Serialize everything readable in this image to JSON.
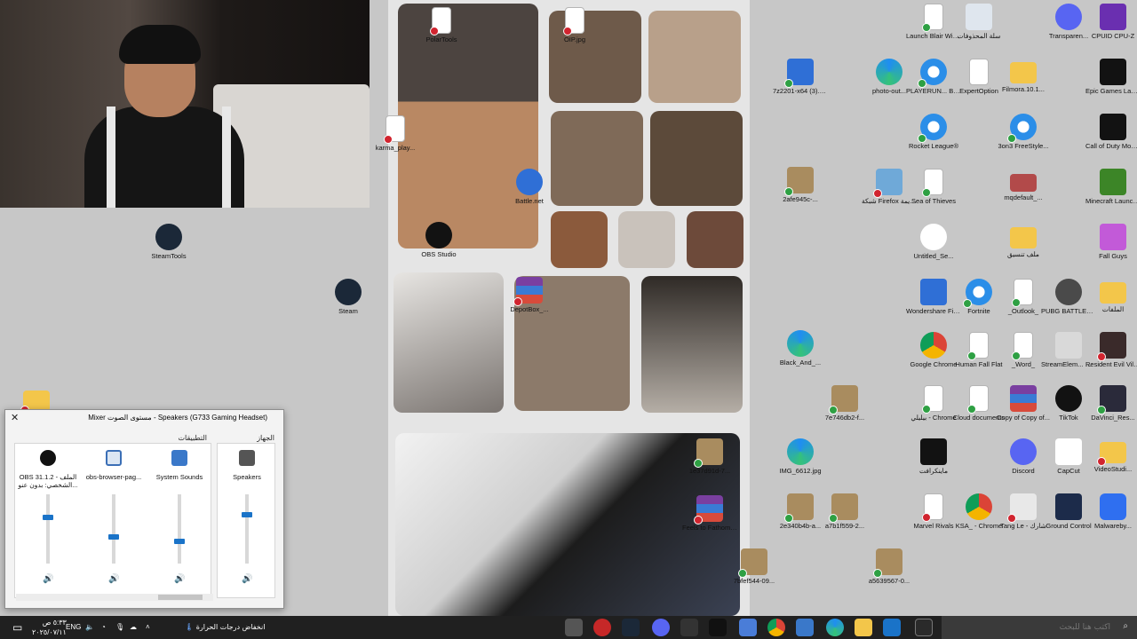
{
  "desktop": {
    "icons_left": [
      {
        "label": "SteamTools",
        "icon": "steam-icon"
      },
      {
        "label": "Steam",
        "icon": "steam-icon"
      }
    ],
    "icons_collage": [
      {
        "label": "PolarTools",
        "icon": "file-icon"
      },
      {
        "label": "OIP.jpg",
        "icon": "image-icon"
      },
      {
        "label": "karma_play...",
        "icon": "file-icon"
      },
      {
        "label": "Battle.net",
        "icon": "battlenet-icon"
      },
      {
        "label": "OBS Studio",
        "icon": "obs-icon"
      },
      {
        "label": "DepotBox_...",
        "icon": "winrar-icon"
      },
      {
        "label": "1e37d91d-7...",
        "icon": "image-icon"
      },
      {
        "label": "Feels to Fathom - I...",
        "icon": "winrar-icon"
      },
      {
        "label": "7bfef544-09...",
        "icon": "image-icon"
      }
    ],
    "icons_right": [
      {
        "label": "7z2201-x64 (3).exe",
        "icon": "installer-icon"
      },
      {
        "label": "photo-out...",
        "icon": "edge-icon"
      },
      {
        "label": "2afe945c-...",
        "icon": "image-icon"
      },
      {
        "label": "Black_And_...",
        "icon": "edge-icon"
      },
      {
        "label": "7e746db2-f...",
        "icon": "image-icon"
      },
      {
        "label": "IMG_6612.jpg",
        "icon": "edge-icon"
      },
      {
        "label": "2e340b4b-a...",
        "icon": "image-icon"
      },
      {
        "label": "a7b1f559-2...",
        "icon": "image-icon"
      },
      {
        "label": "a5639567-0...",
        "icon": "image-icon"
      },
      {
        "label": "Launch Blair Witch",
        "icon": "file-icon"
      },
      {
        "label": "سلة المحذوفات",
        "icon": "recycle-bin-icon"
      },
      {
        "label": "Transparen...",
        "icon": "app-icon"
      },
      {
        "label": "CPUID CPU-Z",
        "icon": "cpuz-icon"
      },
      {
        "label": "PLAYERUN... BATTLEGR...",
        "icon": "ie-icon"
      },
      {
        "label": "ExpertOption",
        "icon": "file-icon"
      },
      {
        "label": "Filmora.10.1...",
        "icon": "folder-icon"
      },
      {
        "label": "Epic Games Launcher",
        "icon": "epic-icon"
      },
      {
        "label": "Rocket League®",
        "icon": "ie-icon"
      },
      {
        "label": "3on3 FreeStyle...",
        "icon": "ie-icon"
      },
      {
        "label": "Call of Duty Modern ...",
        "icon": "cod-icon"
      },
      {
        "label": "شبكة Firefox القديمة",
        "icon": "firefox-icon"
      },
      {
        "label": "Sea of Thieves",
        "icon": "file-icon"
      },
      {
        "label": "mqdefault_...",
        "icon": "image-icon"
      },
      {
        "label": "Minecraft Launcher",
        "icon": "minecraft-icon"
      },
      {
        "label": "Untitled_Se...",
        "icon": "video-icon"
      },
      {
        "label": "ملف تنسيق",
        "icon": "folder-icon"
      },
      {
        "label": "Fall Guys",
        "icon": "fallguys-icon"
      },
      {
        "label": "Wondershare Filmora X",
        "icon": "filmora-icon"
      },
      {
        "label": "Fortnite",
        "icon": "ie-icon"
      },
      {
        "label": "_Outlook_",
        "icon": "file-icon"
      },
      {
        "label": "PUBG BATTLEGR...",
        "icon": "pubg-icon"
      },
      {
        "label": "الملفات",
        "icon": "folder-icon"
      },
      {
        "label": "Google Chrome",
        "icon": "chrome-icon"
      },
      {
        "label": "Human Fall Flat",
        "icon": "file-icon"
      },
      {
        "label": "_Word_",
        "icon": "file-icon"
      },
      {
        "label": "StreamElem... SE.Live",
        "icon": "streamelements-icon"
      },
      {
        "label": "Resident Evil Village",
        "icon": "re-icon"
      },
      {
        "label": "بيليلي - Chrome",
        "icon": "file-icon"
      },
      {
        "label": "Cloud documents",
        "icon": "file-icon"
      },
      {
        "label": "Copy of Copy of...",
        "icon": "winrar-icon"
      },
      {
        "label": "TikTok",
        "icon": "tiktok-icon"
      },
      {
        "label": "DaVinci_Res...",
        "icon": "davinci-icon"
      },
      {
        "label": "ماينكرافت",
        "icon": "app-icon"
      },
      {
        "label": "Discord",
        "icon": "discord-icon"
      },
      {
        "label": "CapCut",
        "icon": "capcut-icon"
      },
      {
        "label": "VideoStudi...",
        "icon": "folder-icon"
      },
      {
        "label": "Marvel Rivals",
        "icon": "file-icon"
      },
      {
        "label": "KSA_ - Chrome",
        "icon": "chrome-icon"
      },
      {
        "label": "Tang Le - شارك",
        "icon": "app-icon"
      },
      {
        "label": "Ground Control",
        "icon": "app-icon"
      },
      {
        "label": "Malwareby...",
        "icon": "malwarebytes-icon"
      }
    ]
  },
  "mixer": {
    "title": "Mixer مستوى الصوت - Speakers (G733 Gaming Headset)",
    "device_section": "الجهاز",
    "apps_section": "التطبيقات",
    "channels": [
      {
        "label": "Speakers",
        "icon": "speaker-device-icon",
        "level": 0.72
      },
      {
        "label": "System Sounds",
        "icon": "system-sounds-icon",
        "level": 0.3
      },
      {
        "label": "obs-browser-pag...",
        "icon": "browser-window-icon",
        "level": 0.38
      },
      {
        "label": "OBS 31.1.2 - الملف الشخصي: بدون عنو...",
        "icon": "obs-icon",
        "level": 0.68
      }
    ]
  },
  "taskbar": {
    "search_placeholder": "اكتب هنا للبحث",
    "weather": "انخفاض درجات الحرارة",
    "language": "ENG",
    "time": "٥:٣٣ ص",
    "date": "٢٠٢٥/٠٧/١١",
    "pinned": [
      "file-explorer-icon",
      "chrome-icon",
      "edge-icon",
      "outlook-icon",
      "store-icon",
      "obs-icon",
      "tiktok-icon",
      "discord-icon",
      "steam-icon",
      "media-player-icon"
    ]
  }
}
